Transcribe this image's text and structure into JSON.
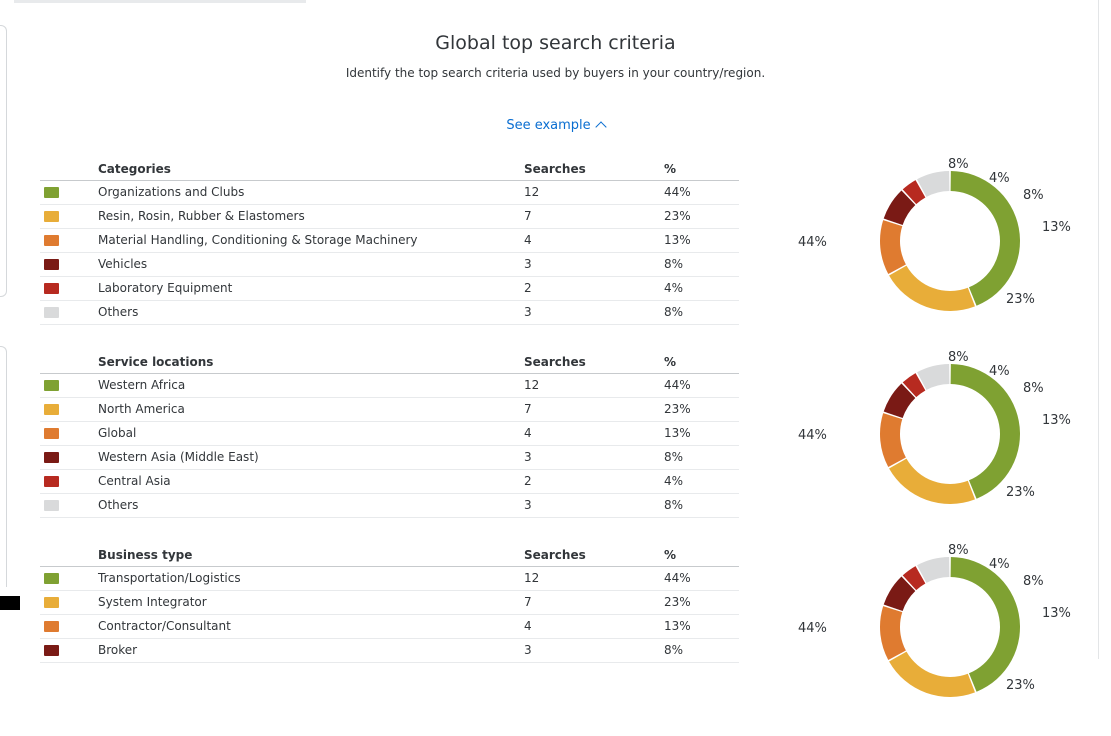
{
  "header": {
    "title": "Global top search criteria",
    "subtitle": "Identify the top search criteria used by buyers in your country/region.",
    "see_example": "See example"
  },
  "colors": [
    "#7fa132",
    "#e8ad39",
    "#df7b30",
    "#7a1a15",
    "#b72a20",
    "#d9dadb"
  ],
  "chart_data": [
    {
      "type": "table",
      "columns": [
        "Categories",
        "Searches",
        "%"
      ],
      "rows": [
        {
          "name": "Organizations and Clubs",
          "searches": "12",
          "pct": "44%"
        },
        {
          "name": "Resin, Rosin, Rubber & Elastomers",
          "searches": "7",
          "pct": "23%"
        },
        {
          "name": "Material Handling, Conditioning & Storage Machinery",
          "searches": "4",
          "pct": "13%"
        },
        {
          "name": "Vehicles",
          "searches": "3",
          "pct": "8%"
        },
        {
          "name": "Laboratory Equipment",
          "searches": "2",
          "pct": "4%"
        },
        {
          "name": "Others",
          "searches": "3",
          "pct": "8%"
        }
      ],
      "donut": {
        "type": "pie",
        "values": [
          44,
          23,
          13,
          8,
          4,
          8
        ],
        "labels": [
          "44%",
          "23%",
          "13%",
          "8%",
          "4%",
          "8%"
        ]
      }
    },
    {
      "type": "table",
      "columns": [
        "Service locations",
        "Searches",
        "%"
      ],
      "rows": [
        {
          "name": "Western Africa",
          "searches": "12",
          "pct": "44%"
        },
        {
          "name": "North America",
          "searches": "7",
          "pct": "23%"
        },
        {
          "name": "Global",
          "searches": "4",
          "pct": "13%"
        },
        {
          "name": "Western Asia (Middle East)",
          "searches": "3",
          "pct": "8%"
        },
        {
          "name": "Central Asia",
          "searches": "2",
          "pct": "4%"
        },
        {
          "name": "Others",
          "searches": "3",
          "pct": "8%"
        }
      ],
      "donut": {
        "type": "pie",
        "values": [
          44,
          23,
          13,
          8,
          4,
          8
        ],
        "labels": [
          "44%",
          "23%",
          "13%",
          "8%",
          "4%",
          "8%"
        ]
      }
    },
    {
      "type": "table",
      "columns": [
        "Business type",
        "Searches",
        "%"
      ],
      "rows": [
        {
          "name": "Transportation/Logistics",
          "searches": "12",
          "pct": "44%"
        },
        {
          "name": "System Integrator",
          "searches": "7",
          "pct": "23%"
        },
        {
          "name": "Contractor/Consultant",
          "searches": "4",
          "pct": "13%"
        },
        {
          "name": "Broker",
          "searches": "3",
          "pct": "8%"
        }
      ],
      "donut": {
        "type": "pie",
        "values": [
          44,
          23,
          13,
          8,
          4,
          8
        ],
        "labels": [
          "44%",
          "23%",
          "13%",
          "8%",
          "4%",
          "8%"
        ]
      }
    }
  ]
}
